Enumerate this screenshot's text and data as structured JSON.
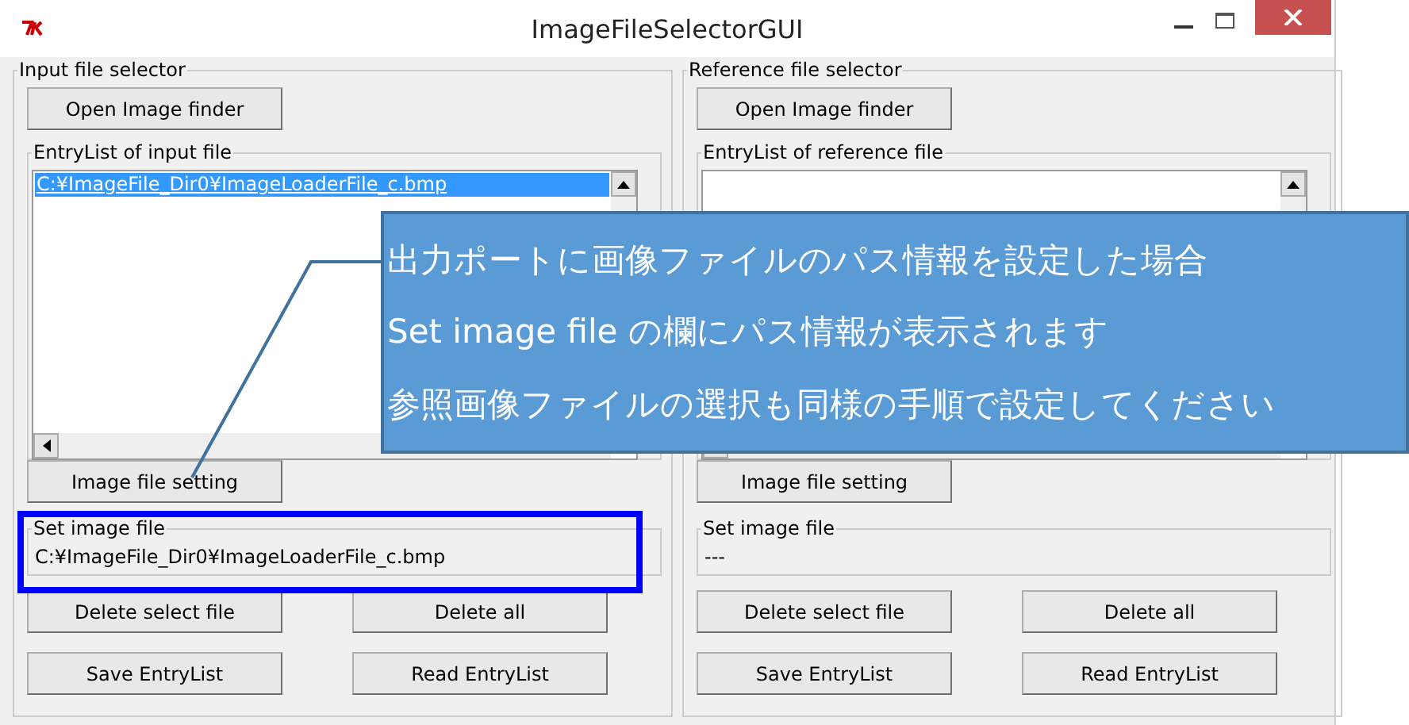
{
  "window": {
    "title": "ImageFileSelectorGUI"
  },
  "panels": [
    {
      "title": "Input file selector",
      "open_button": "Open Image finder",
      "list_title": "EntryList of input file",
      "entries": [
        {
          "text": "C:¥ImageFile_Dir0¥ImageLoaderFile_c.bmp",
          "selected": true
        }
      ],
      "setting_button": "Image file setting",
      "set_image_title": "Set image file",
      "set_image_value": "C:¥ImageFile_Dir0¥ImageLoaderFile_c.bmp",
      "highlighted": true,
      "buttons": [
        "Delete select file",
        "Delete all",
        "Save EntryList",
        "Read EntryList"
      ]
    },
    {
      "title": "Reference file selector",
      "open_button": "Open Image finder",
      "list_title": "EntryList of reference file",
      "setting_button": "Image file setting",
      "set_image_title": "Set image file",
      "set_image_value": "---",
      "highlighted": false,
      "buttons": [
        "Delete select file",
        "Delete all",
        "Save EntryList",
        "Read EntryList"
      ]
    }
  ],
  "callout": {
    "lines": [
      "出力ポートに画像ファイルのパス情報を設定した場合",
      "Set image file の欄にパス情報が表示されます",
      "参照画像ファイルの選択も同様の手順で設定してください"
    ]
  }
}
